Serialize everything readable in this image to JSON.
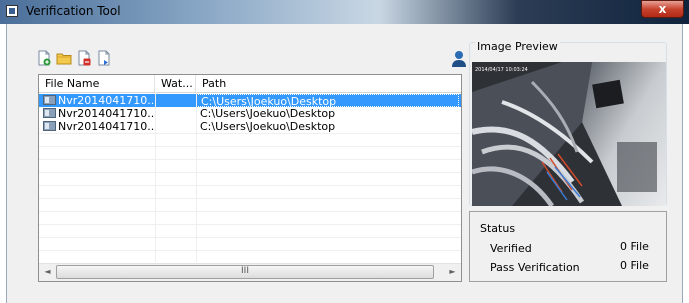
{
  "window": {
    "title": "Verification Tool",
    "close_label": "x"
  },
  "toolbar": {
    "buttons": [
      {
        "name": "add-file-button",
        "icon": "add-file-icon"
      },
      {
        "name": "open-folder-button",
        "icon": "folder-icon"
      },
      {
        "name": "remove-file-button",
        "icon": "remove-file-icon"
      },
      {
        "name": "verify-button",
        "icon": "verify-icon"
      }
    ],
    "user_icon": "user-icon"
  },
  "file_list": {
    "columns": [
      "File Name",
      "Wat...",
      "Path"
    ],
    "rows": [
      {
        "name": "Nvr2014041710...",
        "watermark": "",
        "path": "C:\\Users\\Joekuo\\Desktop",
        "selected": true
      },
      {
        "name": "Nvr2014041710...",
        "watermark": "",
        "path": "C:\\Users\\Joekuo\\Desktop",
        "selected": false
      },
      {
        "name": "Nvr2014041710...",
        "watermark": "",
        "path": "C:\\Users\\Joekuo\\Desktop",
        "selected": false
      }
    ],
    "scroll_left": "◄",
    "scroll_right": "►",
    "scroll_grip": "III"
  },
  "preview": {
    "label": "Image Preview",
    "overlay_text": "2014/04/17 10:03:24"
  },
  "status": {
    "label": "Status",
    "verified_label": "Verified",
    "verified_value": "0 File",
    "pass_label": "Pass Verification",
    "pass_value": "0 File"
  },
  "colors": {
    "selection": "#3399ff",
    "window_bg": "#f0f0f0",
    "close_button": "#c8442e"
  }
}
